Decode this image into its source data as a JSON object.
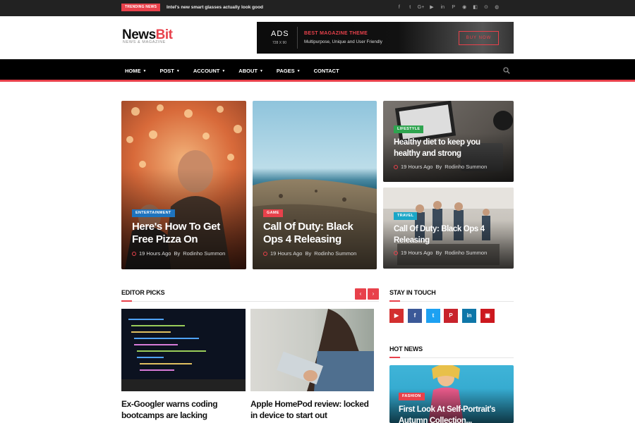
{
  "topbar": {
    "trending_label": "TRENDING NEWS",
    "trending_text": "Intel's new smart glasses actually look good",
    "social_icons": [
      "f",
      "t",
      "G+",
      "▶",
      "in",
      "P",
      "◉",
      "◧",
      "⊙",
      "◍"
    ]
  },
  "header": {
    "logo_main": "News",
    "logo_accent": "Bit",
    "logo_sub": "NEWS & MAGAZINE",
    "ad": {
      "ads": "ADS",
      "size": "728 X 90",
      "title": "BEST MAGAZINE THEME",
      "desc": "Multipurpose, Unique and User Friendly",
      "button": "BUY NOW"
    }
  },
  "nav": {
    "items": [
      {
        "label": "HOME",
        "caret": true
      },
      {
        "label": "POST",
        "caret": true
      },
      {
        "label": "ACCOUNT",
        "caret": true
      },
      {
        "label": "ABOUT",
        "caret": true
      },
      {
        "label": "PAGES",
        "caret": true
      },
      {
        "label": "CONTACT",
        "caret": false
      }
    ]
  },
  "featured": [
    {
      "badge": "ENTERTAINMENT",
      "badge_color": "#1e73be",
      "title_1": "Here's How To Get",
      "title_2": "Free Pizza On",
      "time": "19 Hours Ago",
      "by": "By",
      "author": "Rodinho Summon"
    },
    {
      "badge": "GAME",
      "badge_color": "#e8414b",
      "title_1": "Call Of Duty: Black",
      "title_2": "Ops 4 Releasing",
      "time": "19 Hours Ago",
      "by": "By",
      "author": "Rodinho Summon"
    },
    {
      "badge": "LIFESTYLE",
      "badge_color": "#2ea44f",
      "title_1": "Healthy diet to keep you",
      "title_2": "healthy and strong",
      "time": "19 Hours Ago",
      "by": "By",
      "author": "Rodinho Summon"
    },
    {
      "badge": "TRAVEL",
      "badge_color": "#1aa6c7",
      "title_1": "Call Of Duty: Black Ops 4",
      "title_2": "Releasing",
      "time": "19 Hours Ago",
      "by": "By",
      "author": "Rodinho Summon"
    }
  ],
  "editor": {
    "title": "EDITOR PICKS",
    "prev": "‹",
    "next": "›",
    "picks": [
      {
        "title_1": "Ex-Googler warns coding",
        "title_2": "bootcamps are lacking"
      },
      {
        "title_1": "Apple HomePod review: locked",
        "title_2": "in device to start out"
      }
    ]
  },
  "stay": {
    "title": "STAY IN TOUCH",
    "icons": [
      {
        "glyph": "▶",
        "color": "#d32f2f"
      },
      {
        "glyph": "f",
        "color": "#3b5998"
      },
      {
        "glyph": "t",
        "color": "#1da1f2"
      },
      {
        "glyph": "P",
        "color": "#c8232c"
      },
      {
        "glyph": "in",
        "color": "#0e76a8"
      },
      {
        "glyph": "▣",
        "color": "#cc181e"
      }
    ]
  },
  "hot": {
    "title": "HOT NEWS",
    "badge": "FASHION",
    "title_1": "First Look At Self-Portrait's",
    "title_2": "Autumn Collection..."
  },
  "colors": {
    "accent": "#e8414b"
  }
}
